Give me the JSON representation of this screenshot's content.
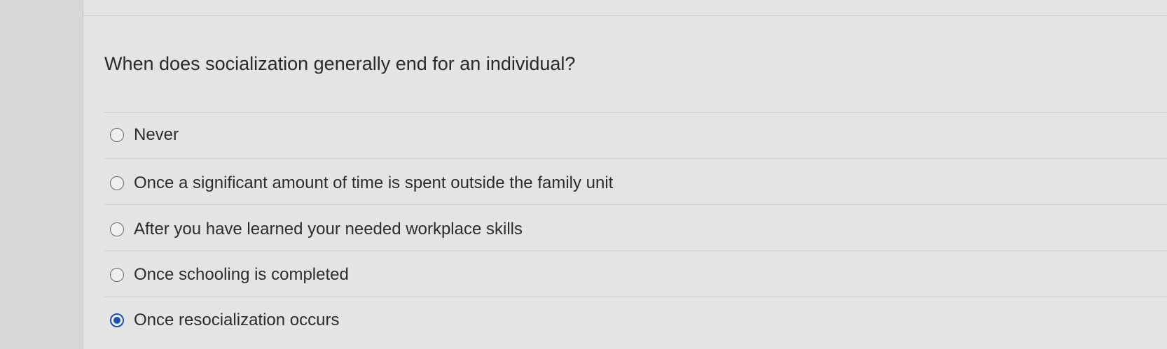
{
  "question": {
    "text": "When does socialization generally end for an individual?"
  },
  "options": [
    {
      "label": "Never",
      "selected": false
    },
    {
      "label": "Once a significant amount of time is spent outside the family unit",
      "selected": false
    },
    {
      "label": "After you have learned your needed workplace skills",
      "selected": false
    },
    {
      "label": "Once schooling is completed",
      "selected": false
    },
    {
      "label": "Once resocialization occurs",
      "selected": true
    }
  ],
  "colors": {
    "selected_radio": "#1d4fb5",
    "text": "#2c2c2c",
    "background": "#e4e4e2"
  }
}
